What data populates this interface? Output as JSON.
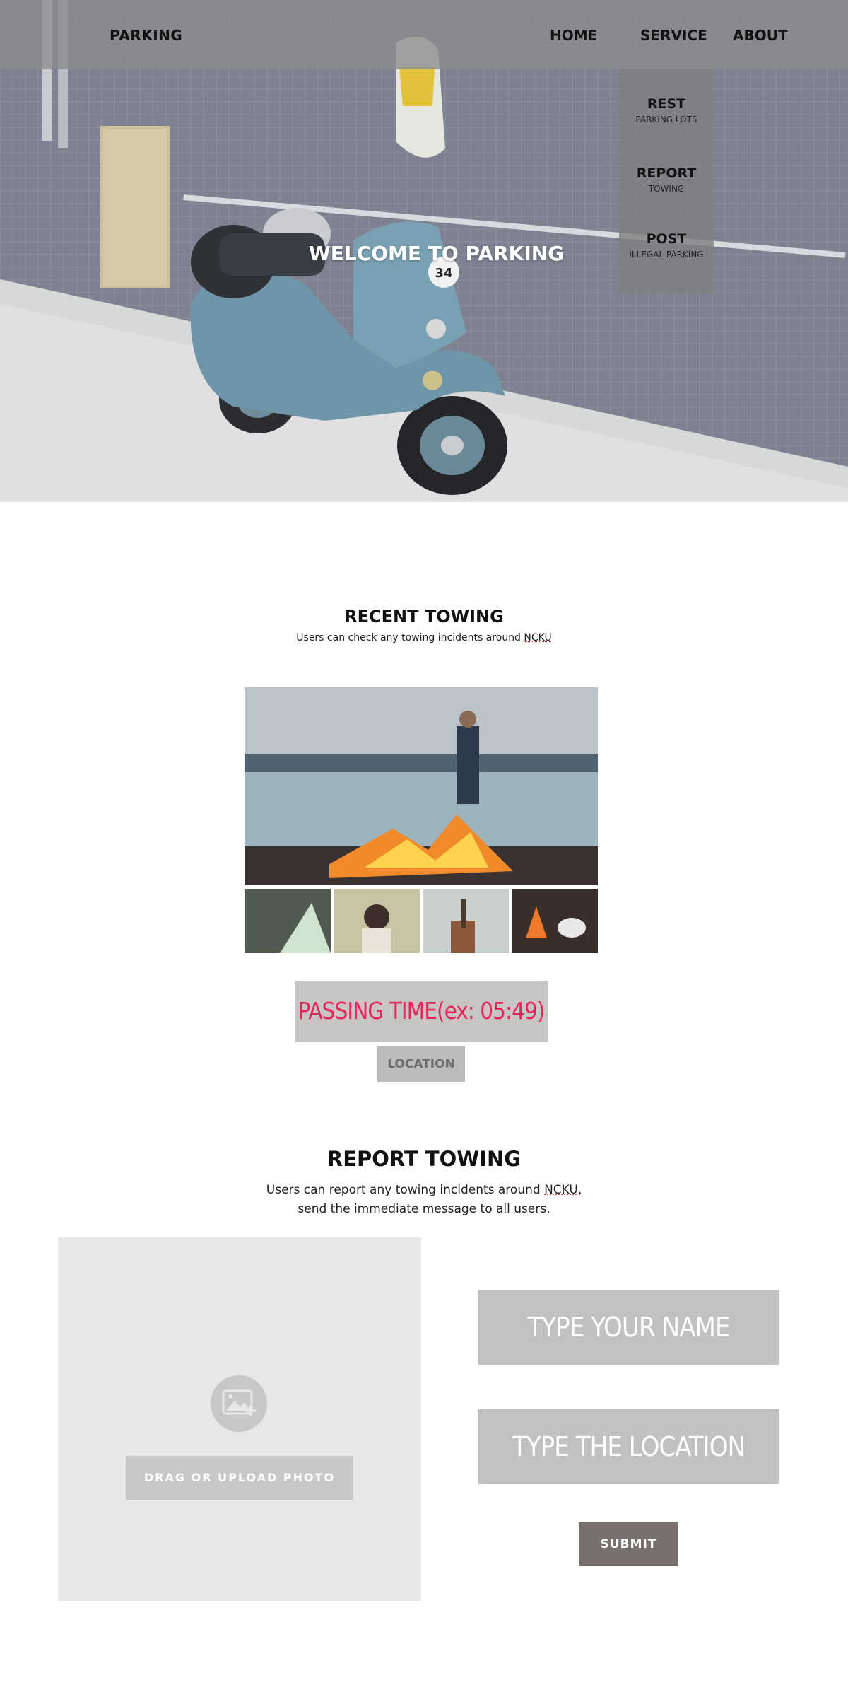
{
  "nav": {
    "brand": "PARKING",
    "items": [
      {
        "label": "HOME"
      },
      {
        "label": "SERVICE"
      },
      {
        "label": "ABOUT"
      }
    ],
    "service_menu": [
      {
        "title": "REST",
        "sub": "PARKING LOTS"
      },
      {
        "title": "REPORT",
        "sub": "TOWING"
      },
      {
        "title": "POST",
        "sub": "ILLEGAL PARKING"
      }
    ]
  },
  "hero": {
    "title": "WELCOME TO PARKING",
    "scooter_number": "34"
  },
  "recent": {
    "title": "RECENT TOWING",
    "subtitle_prefix": "Users can check any towing incidents around ",
    "subtitle_ncku": "NCKU",
    "passing_time": "PASSING TIME(ex: 05:49)",
    "location_button": "LOCATION"
  },
  "report": {
    "title": "REPORT TOWING",
    "subtitle_line1_prefix": "Users can report any towing incidents around ",
    "subtitle_line1_ncku": "NCKU",
    "subtitle_line1_suffix": ",",
    "subtitle_line2": "send the immediate message to all users.",
    "upload_label": "DRAG OR UPLOAD PHOTO",
    "name_field": "TYPE YOUR NAME",
    "location_field": "TYPE THE LOCATION",
    "submit_label": "SUBMIT"
  },
  "colors": {
    "navbar": "#8c8c8c",
    "accent_text": "#e8255a",
    "field_bg": "#c2c1c0",
    "submit_bg": "#786f6f",
    "upload_panel_bg": "#e6e7e8"
  }
}
